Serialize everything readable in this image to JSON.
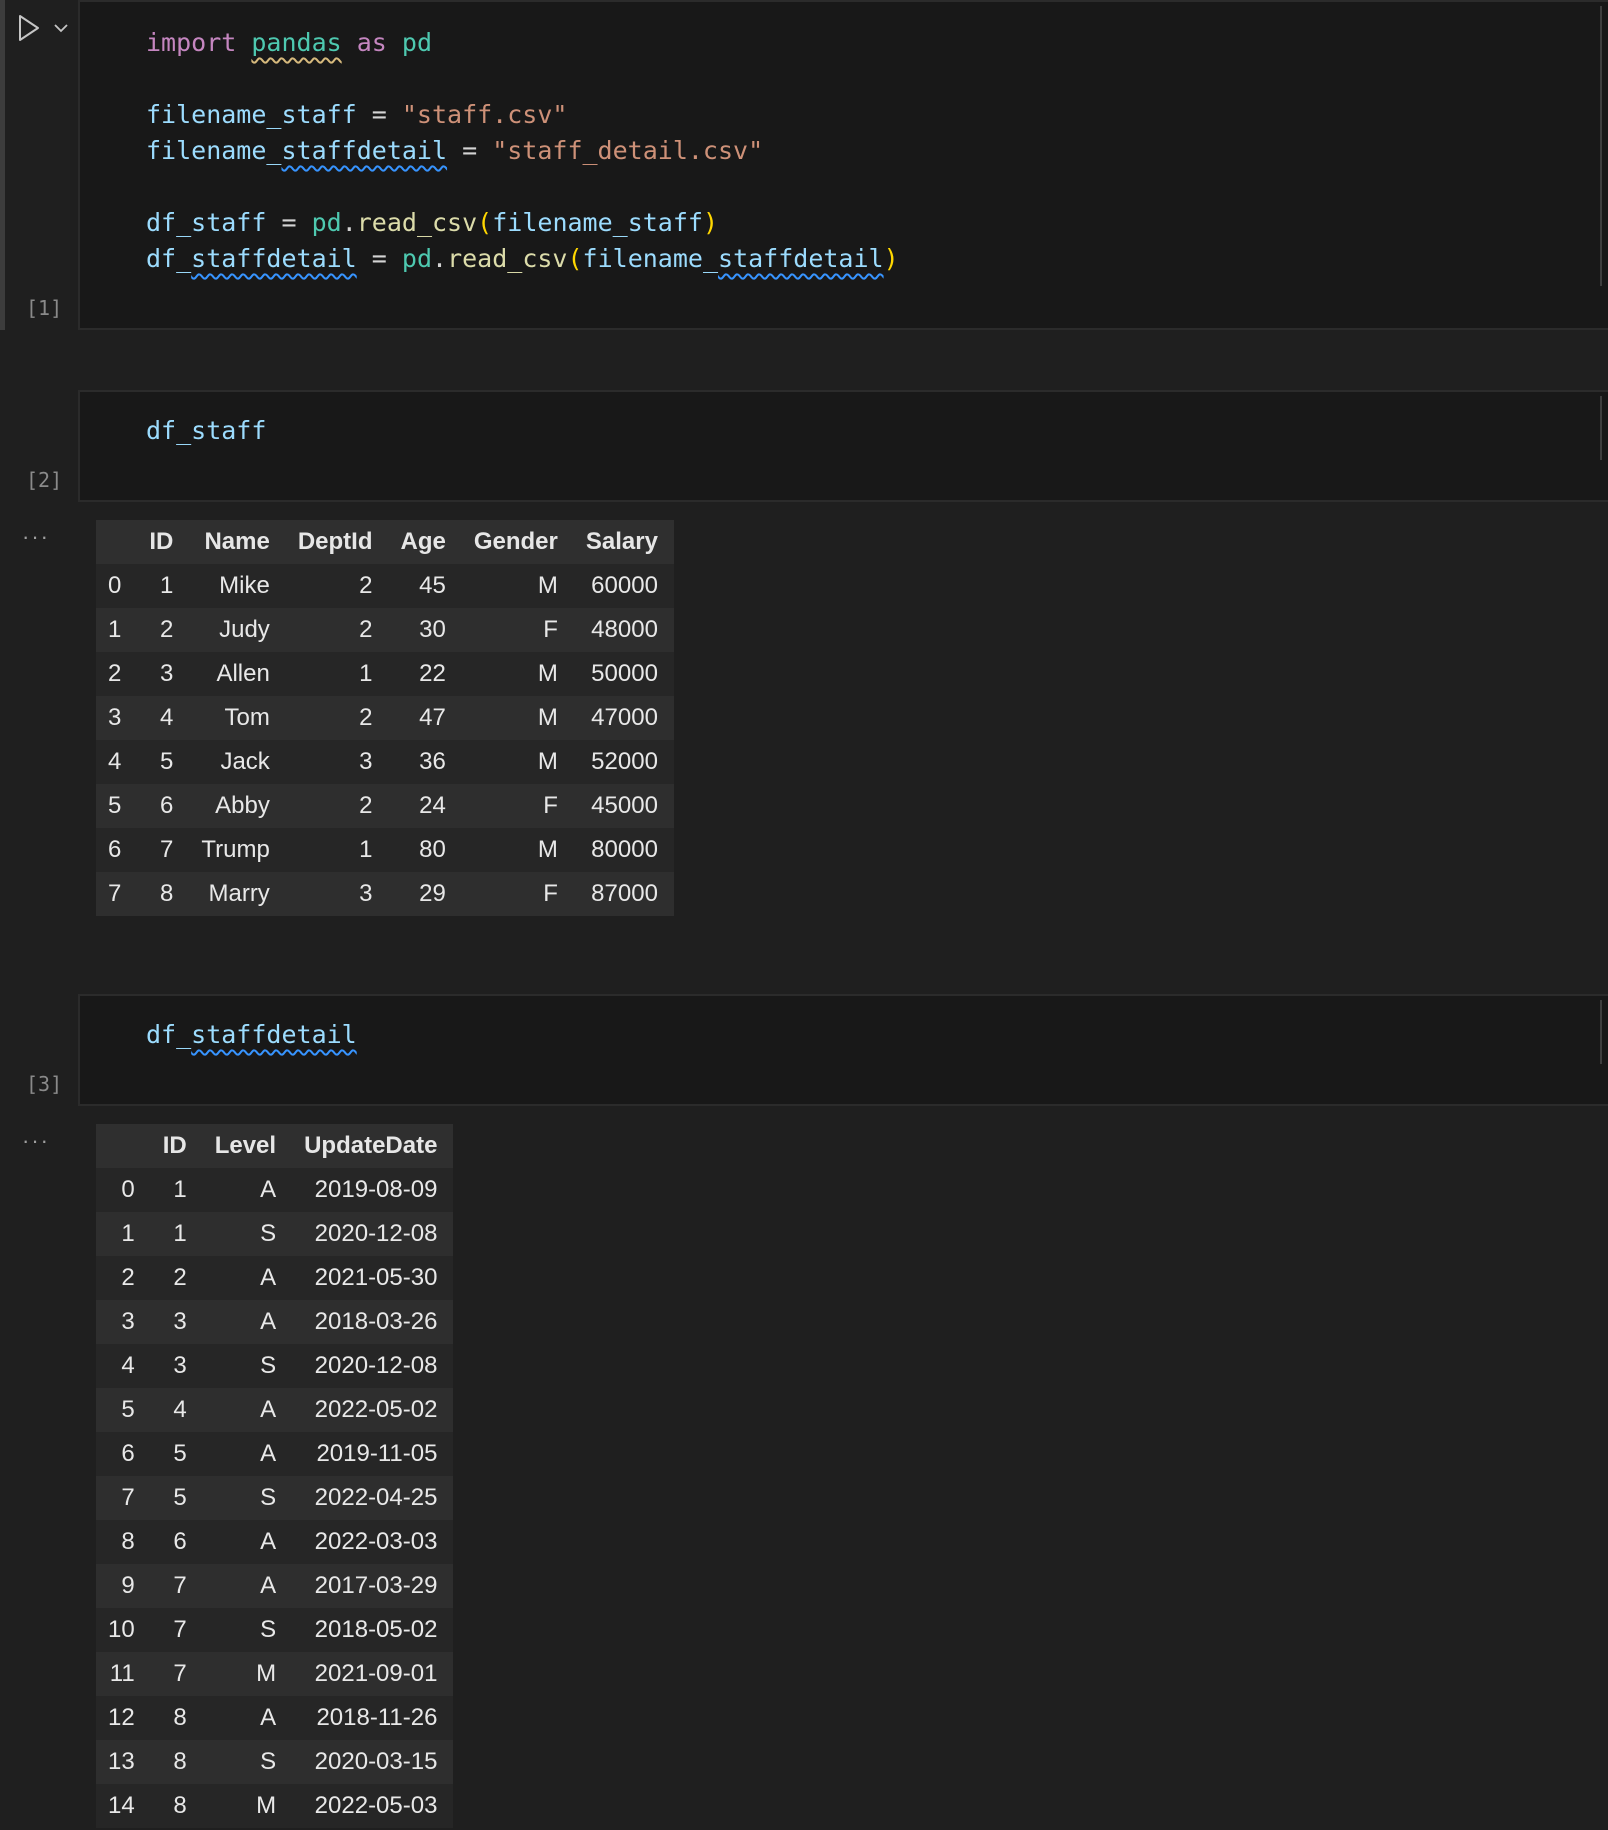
{
  "cells": [
    {
      "exec_count": "[1]",
      "code": {
        "line1": {
          "import": "import",
          "module": "pandas",
          "as": "as",
          "alias": "pd"
        },
        "line2": {
          "var": "filename_staff",
          "eq": " = ",
          "str": "\"staff.csv\""
        },
        "line3": {
          "var_a": "filename_",
          "var_b": "staffdetail",
          "eq": " = ",
          "str": "\"staff_detail.csv\""
        },
        "line4": {
          "var": "df_staff",
          "eq": " = ",
          "mod": "pd",
          "dot": ".",
          "fn": "read_csv",
          "lp": "(",
          "arg": "filename_staff",
          "rp": ")"
        },
        "line5": {
          "var_a": "df_",
          "var_b": "staffdetail",
          "eq": " = ",
          "mod": "pd",
          "dot": ".",
          "fn": "read_csv",
          "lp": "(",
          "arg_a": "filename_",
          "arg_b": "staffdetail",
          "rp": ")"
        }
      }
    },
    {
      "exec_count": "[2]",
      "code": {
        "var": "df_staff"
      }
    },
    {
      "exec_count": "[3]",
      "code": {
        "var_a": "df_",
        "var_b": "staffdetail"
      }
    }
  ],
  "outputs": {
    "more_label": "···",
    "staff_table": {
      "columns": [
        "",
        "ID",
        "Name",
        "DeptId",
        "Age",
        "Gender",
        "Salary"
      ],
      "rows": [
        [
          "0",
          "1",
          "Mike",
          "2",
          "45",
          "M",
          "60000"
        ],
        [
          "1",
          "2",
          "Judy",
          "2",
          "30",
          "F",
          "48000"
        ],
        [
          "2",
          "3",
          "Allen",
          "1",
          "22",
          "M",
          "50000"
        ],
        [
          "3",
          "4",
          "Tom",
          "2",
          "47",
          "M",
          "47000"
        ],
        [
          "4",
          "5",
          "Jack",
          "3",
          "36",
          "M",
          "52000"
        ],
        [
          "5",
          "6",
          "Abby",
          "2",
          "24",
          "F",
          "45000"
        ],
        [
          "6",
          "7",
          "Trump",
          "1",
          "80",
          "M",
          "80000"
        ],
        [
          "7",
          "8",
          "Marry",
          "3",
          "29",
          "F",
          "87000"
        ]
      ]
    },
    "staffdetail_table": {
      "columns": [
        "",
        "ID",
        "Level",
        "UpdateDate"
      ],
      "rows": [
        [
          "0",
          "1",
          "A",
          "2019-08-09"
        ],
        [
          "1",
          "1",
          "S",
          "2020-12-08"
        ],
        [
          "2",
          "2",
          "A",
          "2021-05-30"
        ],
        [
          "3",
          "3",
          "A",
          "2018-03-26"
        ],
        [
          "4",
          "3",
          "S",
          "2020-12-08"
        ],
        [
          "5",
          "4",
          "A",
          "2022-05-02"
        ],
        [
          "6",
          "5",
          "A",
          "2019-11-05"
        ],
        [
          "7",
          "5",
          "S",
          "2022-04-25"
        ],
        [
          "8",
          "6",
          "A",
          "2022-03-03"
        ],
        [
          "9",
          "7",
          "A",
          "2017-03-29"
        ],
        [
          "10",
          "7",
          "S",
          "2018-05-02"
        ],
        [
          "11",
          "7",
          "M",
          "2021-09-01"
        ],
        [
          "12",
          "8",
          "A",
          "2018-11-26"
        ],
        [
          "13",
          "8",
          "S",
          "2020-03-15"
        ],
        [
          "14",
          "8",
          "M",
          "2022-05-03"
        ]
      ]
    }
  },
  "icons": {
    "run": "play-icon",
    "run_menu": "chevron-down-icon"
  }
}
